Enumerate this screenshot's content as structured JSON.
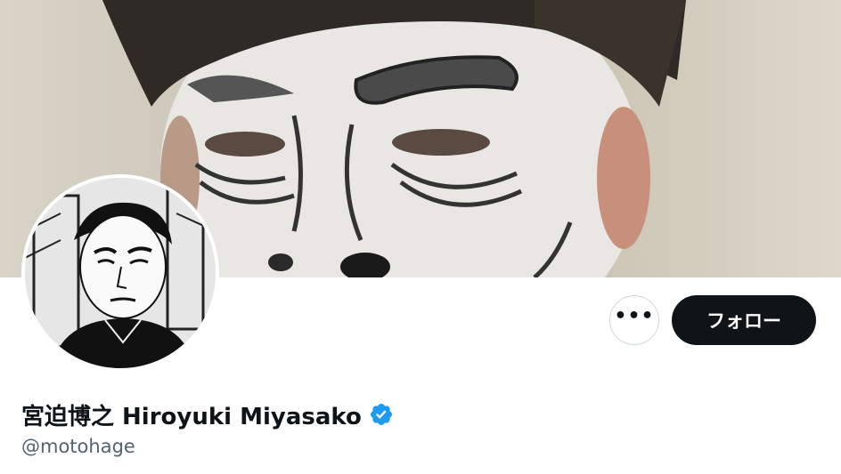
{
  "profile": {
    "display_name": "宮迫博之 Hiroyuki Miyasako",
    "handle": "@motohage",
    "verified": true
  },
  "actions": {
    "more_label": "•••",
    "follow_label": "フォロー"
  },
  "colors": {
    "primary_text": "#0f1419",
    "secondary_text": "#536471",
    "follow_button_bg": "#0f1419",
    "verified_badge": "#1d9bf0",
    "border": "#cfd9de"
  },
  "icons": {
    "more": "more-horizontal-icon",
    "verified": "verified-badge-icon"
  }
}
